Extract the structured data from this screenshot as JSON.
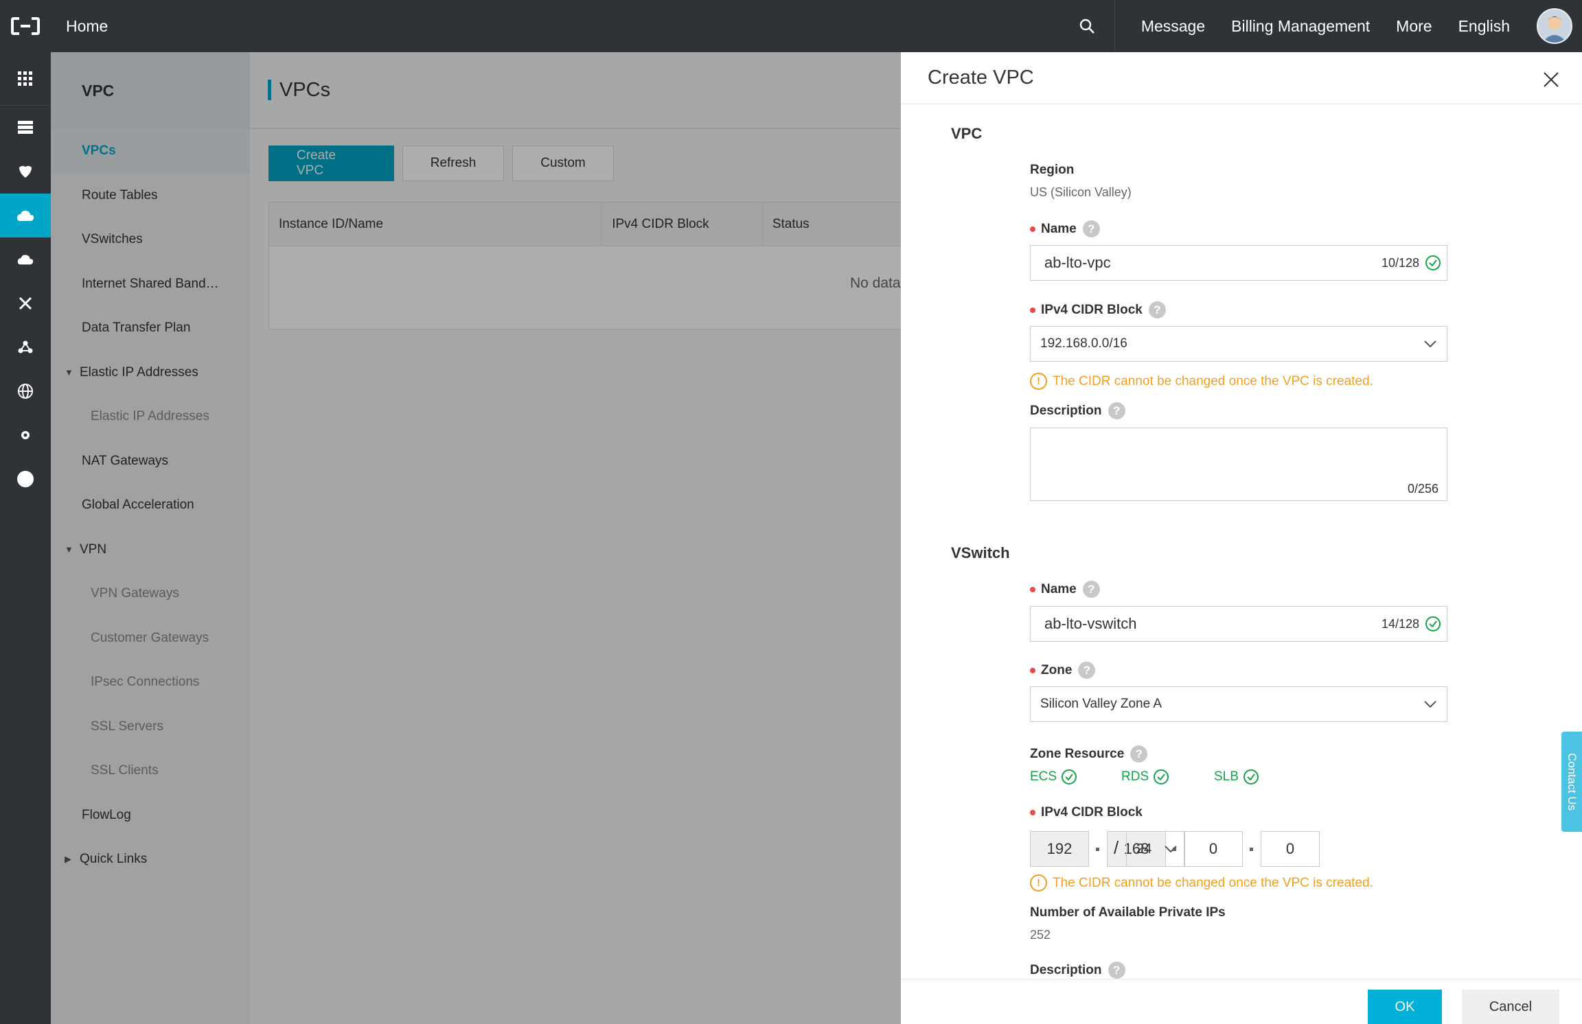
{
  "topbar": {
    "home": "Home",
    "links": [
      "Message",
      "Billing Management",
      "More",
      "English"
    ]
  },
  "nav": {
    "header": "VPC",
    "items": [
      {
        "label": "VPCs",
        "kind": "active"
      },
      {
        "label": "Route Tables",
        "kind": "normal"
      },
      {
        "label": "VSwitches",
        "kind": "normal"
      },
      {
        "label": "Internet Shared Band…",
        "kind": "normal"
      },
      {
        "label": "Data Transfer Plan",
        "kind": "normal"
      },
      {
        "label": "Elastic IP Addresses",
        "kind": "group-open"
      },
      {
        "label": "Elastic IP Addresses",
        "kind": "sub"
      },
      {
        "label": "NAT Gateways",
        "kind": "normal"
      },
      {
        "label": "Global Acceleration",
        "kind": "normal"
      },
      {
        "label": "VPN",
        "kind": "group-open"
      },
      {
        "label": "VPN Gateways",
        "kind": "sub"
      },
      {
        "label": "Customer Gateways",
        "kind": "sub"
      },
      {
        "label": "IPsec Connections",
        "kind": "sub"
      },
      {
        "label": "SSL Servers",
        "kind": "sub"
      },
      {
        "label": "SSL Clients",
        "kind": "sub"
      },
      {
        "label": "FlowLog",
        "kind": "normal"
      },
      {
        "label": "Quick Links",
        "kind": "group-closed"
      }
    ]
  },
  "main": {
    "title": "VPCs",
    "buttons": {
      "create": "Create VPC",
      "refresh": "Refresh",
      "custom": "Custom"
    },
    "columns": [
      "Instance ID/Name",
      "IPv4 CIDR Block",
      "Status"
    ],
    "empty": "No data"
  },
  "drawer": {
    "title": "Create VPC",
    "vpc_section": "VPC",
    "region_label": "Region",
    "region_value": "US (Silicon Valley)",
    "name_label": "Name",
    "name_value": "ab-lto-vpc",
    "name_count": "10/128",
    "cidr_label": "IPv4 CIDR Block",
    "cidr_value": "192.168.0.0/16",
    "warning": "The CIDR cannot be changed once the VPC is created.",
    "desc_label": "Description",
    "desc_count": "0/256",
    "vswitch_section": "VSwitch",
    "vs_name_label": "Name",
    "vs_name_value": "ab-lto-vswitch",
    "vs_name_count": "14/128",
    "zone_label": "Zone",
    "zone_value": "Silicon Valley Zone A",
    "zone_resource_label": "Zone Resource",
    "zone_resources": [
      "ECS",
      "RDS",
      "SLB"
    ],
    "vs_cidr_label": "IPv4 CIDR Block",
    "octets": [
      "192",
      "168",
      "0",
      "0"
    ],
    "mask": "24",
    "available_label": "Number of Available Private IPs",
    "available_value": "252",
    "vs_desc_label": "Description",
    "ok": "OK",
    "cancel": "Cancel",
    "contact": "Contact Us"
  },
  "colors": {
    "accent": "#00a5c8",
    "warning": "#f0a020",
    "success": "#16a34a",
    "topbar": "#2f3337"
  }
}
